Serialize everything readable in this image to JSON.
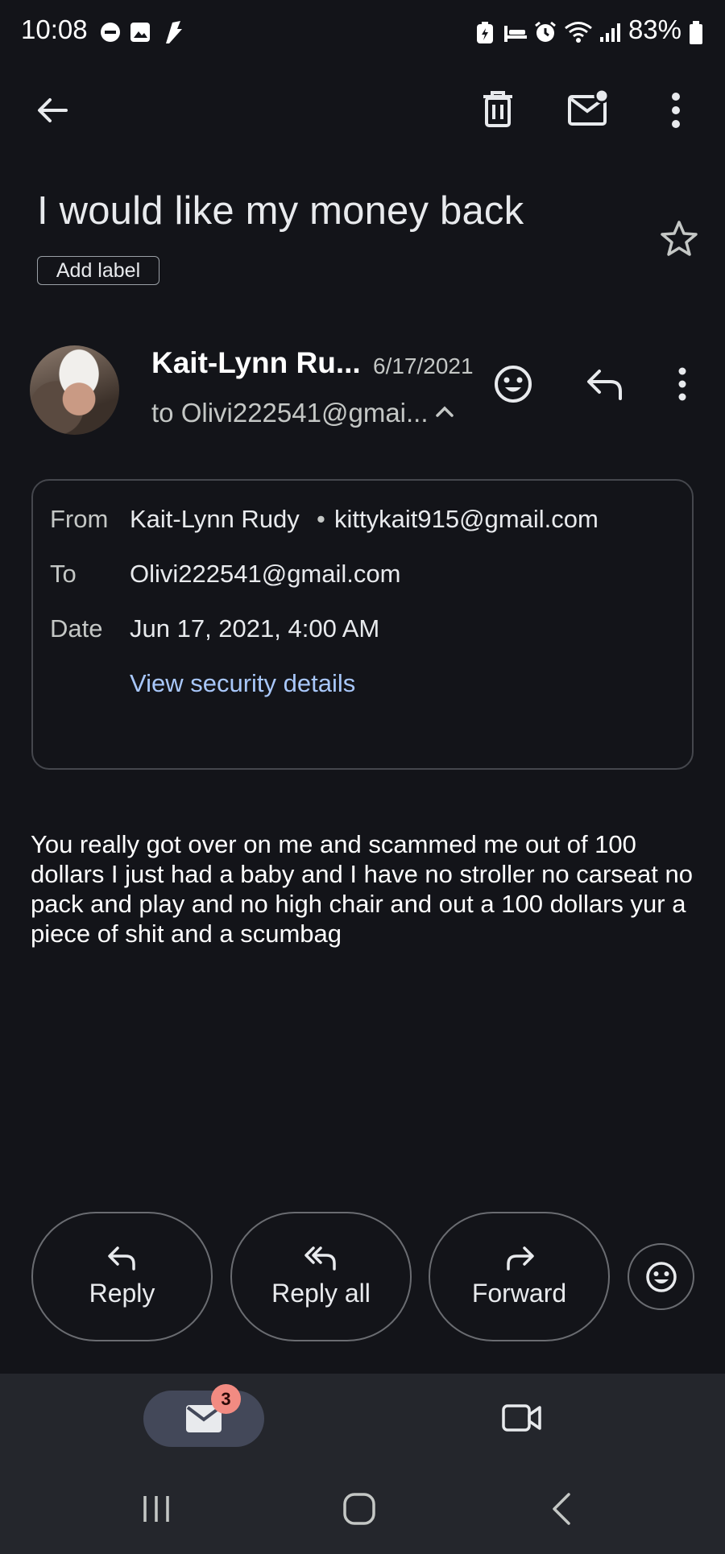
{
  "status_bar": {
    "time": "10:08",
    "battery_percent": "83%"
  },
  "toolbar": {
    "back": "back-arrow-icon",
    "delete": "trash-icon",
    "mark_unread": "mark-unread-icon",
    "more": "more-vert-icon"
  },
  "subject": "I would like my money back",
  "add_label": "Add label",
  "sender": {
    "name": "Kait-Lynn Ru...",
    "date": "6/17/2021",
    "to_line": "to Olivi222541@gmai..."
  },
  "details": {
    "from_label": "From",
    "from_name": "Kait-Lynn Rudy",
    "separator": "•",
    "from_email": "kittykait915@gmail.com",
    "to_label": "To",
    "to_value": "Olivi222541@gmail.com",
    "date_label": "Date",
    "date_value": "Jun 17, 2021, 4:00 AM",
    "security_link": "View security details"
  },
  "body": "You really got over on me and scammed me out of 100 dollars I just had a baby and I have no stroller no carseat no pack and play and no high chair and out a 100 dollars yur a piece of shit and a scumbag",
  "actions": {
    "reply": "Reply",
    "reply_all": "Reply all",
    "forward": "Forward"
  },
  "bottom_nav": {
    "mail_badge": "3"
  },
  "colors": {
    "background": "#131419",
    "link": "#a8c7fa",
    "badge": "#f28b82"
  }
}
